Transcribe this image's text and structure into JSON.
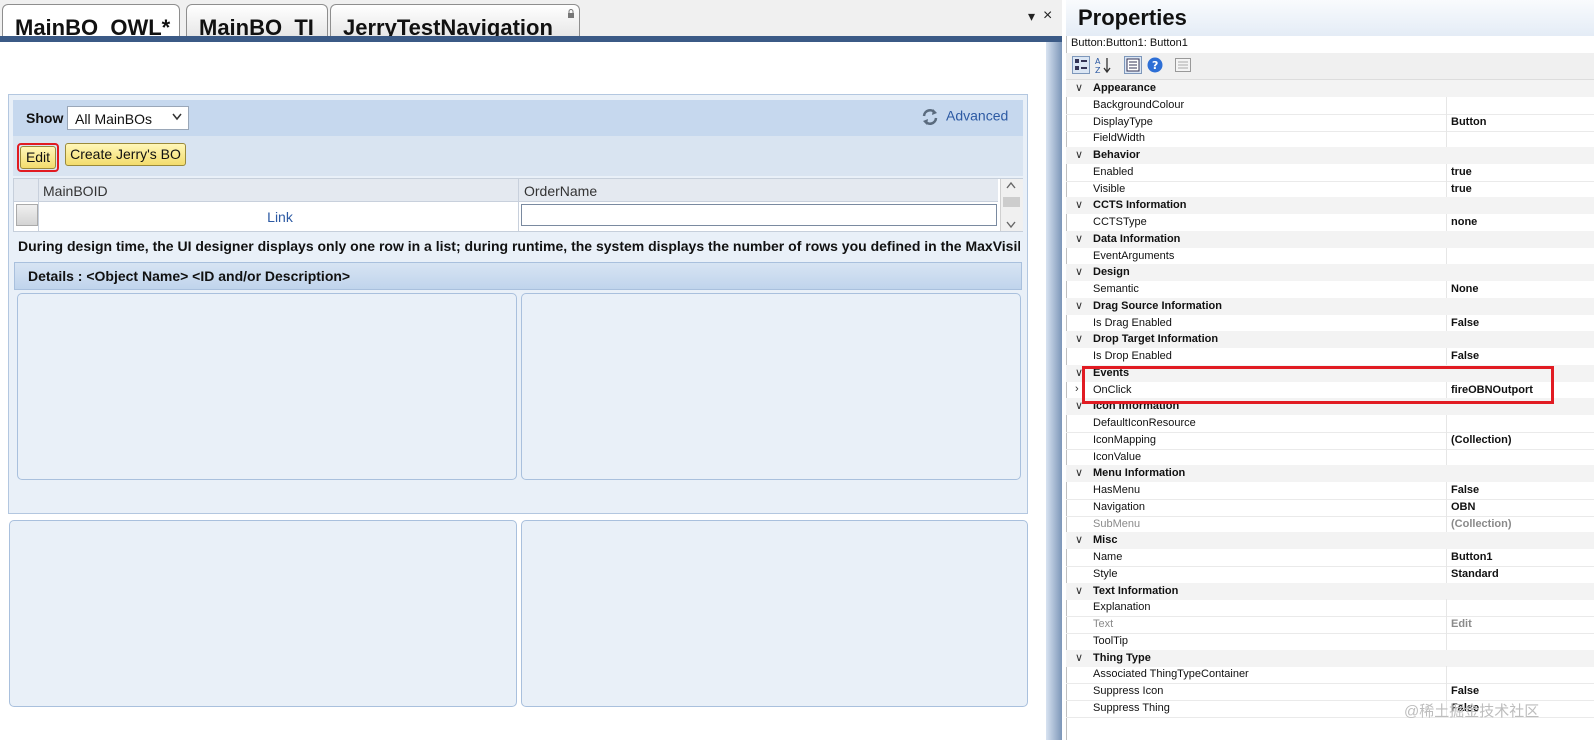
{
  "tabs": [
    {
      "label": "MainBO_OWL*",
      "active": true
    },
    {
      "label": "MainBO_TI",
      "active": false
    },
    {
      "label": "JerryTestNavigation",
      "active": false
    }
  ],
  "tab_controls": {
    "dropdown": "▾",
    "close": "×"
  },
  "toolbar": {
    "show_label": "Show",
    "show_value": "All MainBOs",
    "advanced_label": "Advanced",
    "edit_label": "Edit",
    "create_label": "Create Jerry's BO"
  },
  "table": {
    "columns": [
      "MainBOID",
      "OrderName"
    ],
    "row_link": "Link"
  },
  "design_note": "During design time, the UI designer displays only one row in a list; during runtime, the system displays the number of rows you defined in the MaxVisibleRo",
  "details_header": "Details : <Object Name> <ID and/or Description>",
  "properties": {
    "title": "Properties",
    "object": "Button:Button1: Button1",
    "rows": [
      {
        "type": "cat",
        "name": "Appearance",
        "expander": "∨"
      },
      {
        "type": "prop",
        "name": "BackgroundColour",
        "value": ""
      },
      {
        "type": "prop",
        "name": "DisplayType",
        "value": "Button"
      },
      {
        "type": "prop",
        "name": "FieldWidth",
        "value": ""
      },
      {
        "type": "cat",
        "name": "Behavior",
        "expander": "∨"
      },
      {
        "type": "prop",
        "name": "Enabled",
        "value": "true"
      },
      {
        "type": "prop",
        "name": "Visible",
        "value": "true"
      },
      {
        "type": "cat",
        "name": "CCTS Information",
        "expander": "∨"
      },
      {
        "type": "prop",
        "name": "CCTSType",
        "value": "none"
      },
      {
        "type": "cat",
        "name": "Data Information",
        "expander": "∨"
      },
      {
        "type": "prop",
        "name": "EventArguments",
        "value": ""
      },
      {
        "type": "cat",
        "name": "Design",
        "expander": "∨"
      },
      {
        "type": "prop",
        "name": "Semantic",
        "value": "None"
      },
      {
        "type": "cat",
        "name": "Drag Source Information",
        "expander": "∨"
      },
      {
        "type": "prop",
        "name": "Is Drag Enabled",
        "value": "False"
      },
      {
        "type": "cat",
        "name": "Drop Target Information",
        "expander": "∨"
      },
      {
        "type": "prop",
        "name": "Is Drop Enabled",
        "value": "False"
      },
      {
        "type": "cat",
        "name": "Events",
        "expander": "∨"
      },
      {
        "type": "prop",
        "name": "OnClick",
        "value": "fireOBNOutport",
        "expander": "›"
      },
      {
        "type": "cat",
        "name": "Icon Information",
        "expander": "∨"
      },
      {
        "type": "prop",
        "name": "DefaultIconResource",
        "value": ""
      },
      {
        "type": "prop",
        "name": "IconMapping",
        "value": "(Collection)"
      },
      {
        "type": "prop",
        "name": "IconValue",
        "value": ""
      },
      {
        "type": "cat",
        "name": "Menu Information",
        "expander": "∨"
      },
      {
        "type": "prop",
        "name": "HasMenu",
        "value": "False"
      },
      {
        "type": "prop",
        "name": "Navigation",
        "value": "OBN"
      },
      {
        "type": "prop",
        "name": "SubMenu",
        "value": "(Collection)",
        "muted": true
      },
      {
        "type": "cat",
        "name": "Misc",
        "expander": "∨"
      },
      {
        "type": "prop",
        "name": "Name",
        "value": "Button1"
      },
      {
        "type": "prop",
        "name": "Style",
        "value": "Standard"
      },
      {
        "type": "cat",
        "name": "Text Information",
        "expander": "∨"
      },
      {
        "type": "prop",
        "name": "Explanation",
        "value": ""
      },
      {
        "type": "prop",
        "name": "Text",
        "value": "Edit",
        "muted": true
      },
      {
        "type": "prop",
        "name": "ToolTip",
        "value": ""
      },
      {
        "type": "cat",
        "name": "Thing Type",
        "expander": "∨"
      },
      {
        "type": "prop",
        "name": "Associated ThingTypeContainer",
        "value": ""
      },
      {
        "type": "prop",
        "name": "Suppress Icon",
        "value": "False"
      },
      {
        "type": "prop",
        "name": "Suppress Thing",
        "value": "False"
      }
    ]
  },
  "watermark": "@稀土掘金技术社区",
  "colors": {
    "highlight_red": "#e11b22",
    "link_blue": "#2d5aa3",
    "button_yellow": "#f3dc6d",
    "panel_blue": "#c6d8ee"
  }
}
